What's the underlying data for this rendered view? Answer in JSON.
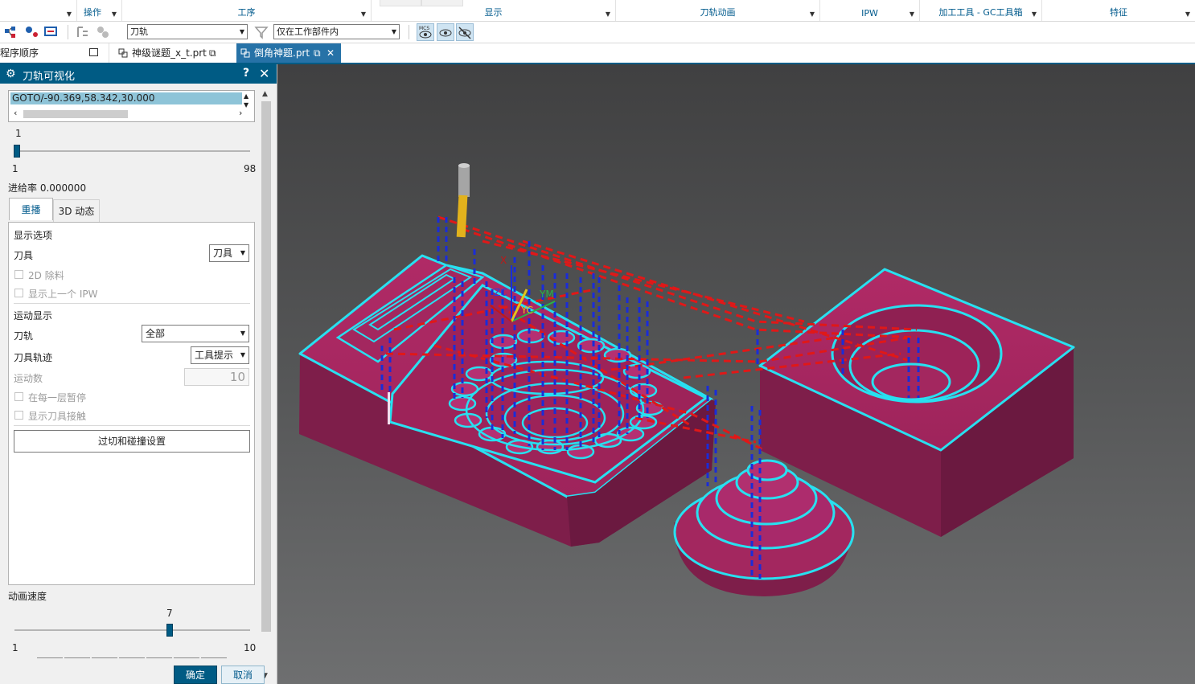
{
  "ribbon": {
    "groups": [
      {
        "label": ""
      },
      {
        "label": "操作"
      },
      {
        "label": "工序"
      },
      {
        "label": "显示"
      },
      {
        "label": "刀轨动画"
      },
      {
        "label": "IPW"
      },
      {
        "label": "加工工具 - GC工具箱"
      },
      {
        "label": "特征"
      }
    ]
  },
  "toolbar": {
    "type_filter": "刀轨",
    "scope_filter": "仅在工作部件内"
  },
  "tabs": {
    "navigator": "程序顺序",
    "files": [
      {
        "label": "神级谜题_x_t.prt",
        "active": false
      },
      {
        "label": "倒角神题.prt",
        "active": true
      }
    ]
  },
  "dialog": {
    "title": "刀轨可视化",
    "help": "?",
    "close": "✕",
    "goto_line": "GOTO/-90.369,58.342,30.000",
    "step_slider": {
      "current": "1",
      "min": "1",
      "max": "98",
      "value": 1,
      "max_value": 98
    },
    "feed_rate": "进给率 0.000000",
    "tab_replay": "重播",
    "tab_3d": "3D 动态",
    "display_options": "显示选项",
    "tool_label": "刀具",
    "tool_value": "刀具",
    "opt_2d_stock": "2D 除料",
    "opt_prev_ipw": "显示上一个 IPW",
    "motion_display": "运动显示",
    "toolpath_label": "刀轨",
    "toolpath_value": "全部",
    "tool_trace_label": "刀具轨迹",
    "tool_trace_value": "工具提示",
    "motion_count_label": "运动数",
    "motion_count_value": "10",
    "opt_pause_each_layer": "在每一层暂停",
    "opt_show_tool_contact": "显示刀具接触",
    "gouge_button": "过切和碰撞设置",
    "anim_speed_label": "动画速度",
    "speed_slider": {
      "current": "7",
      "min": "1",
      "max": "10",
      "value": 7,
      "max_value": 10
    },
    "ok": "确定",
    "cancel": "取消"
  },
  "viewport": {
    "axis_labels": {
      "zc": "ZC",
      "ym": "YM",
      "yc": "YC",
      "xm": "X"
    },
    "colors": {
      "part": "#a3275f",
      "edge": "#28e0f0",
      "rapid": "#e01818",
      "plunge": "#1a2cd8",
      "tool": "#e2b21c"
    }
  }
}
